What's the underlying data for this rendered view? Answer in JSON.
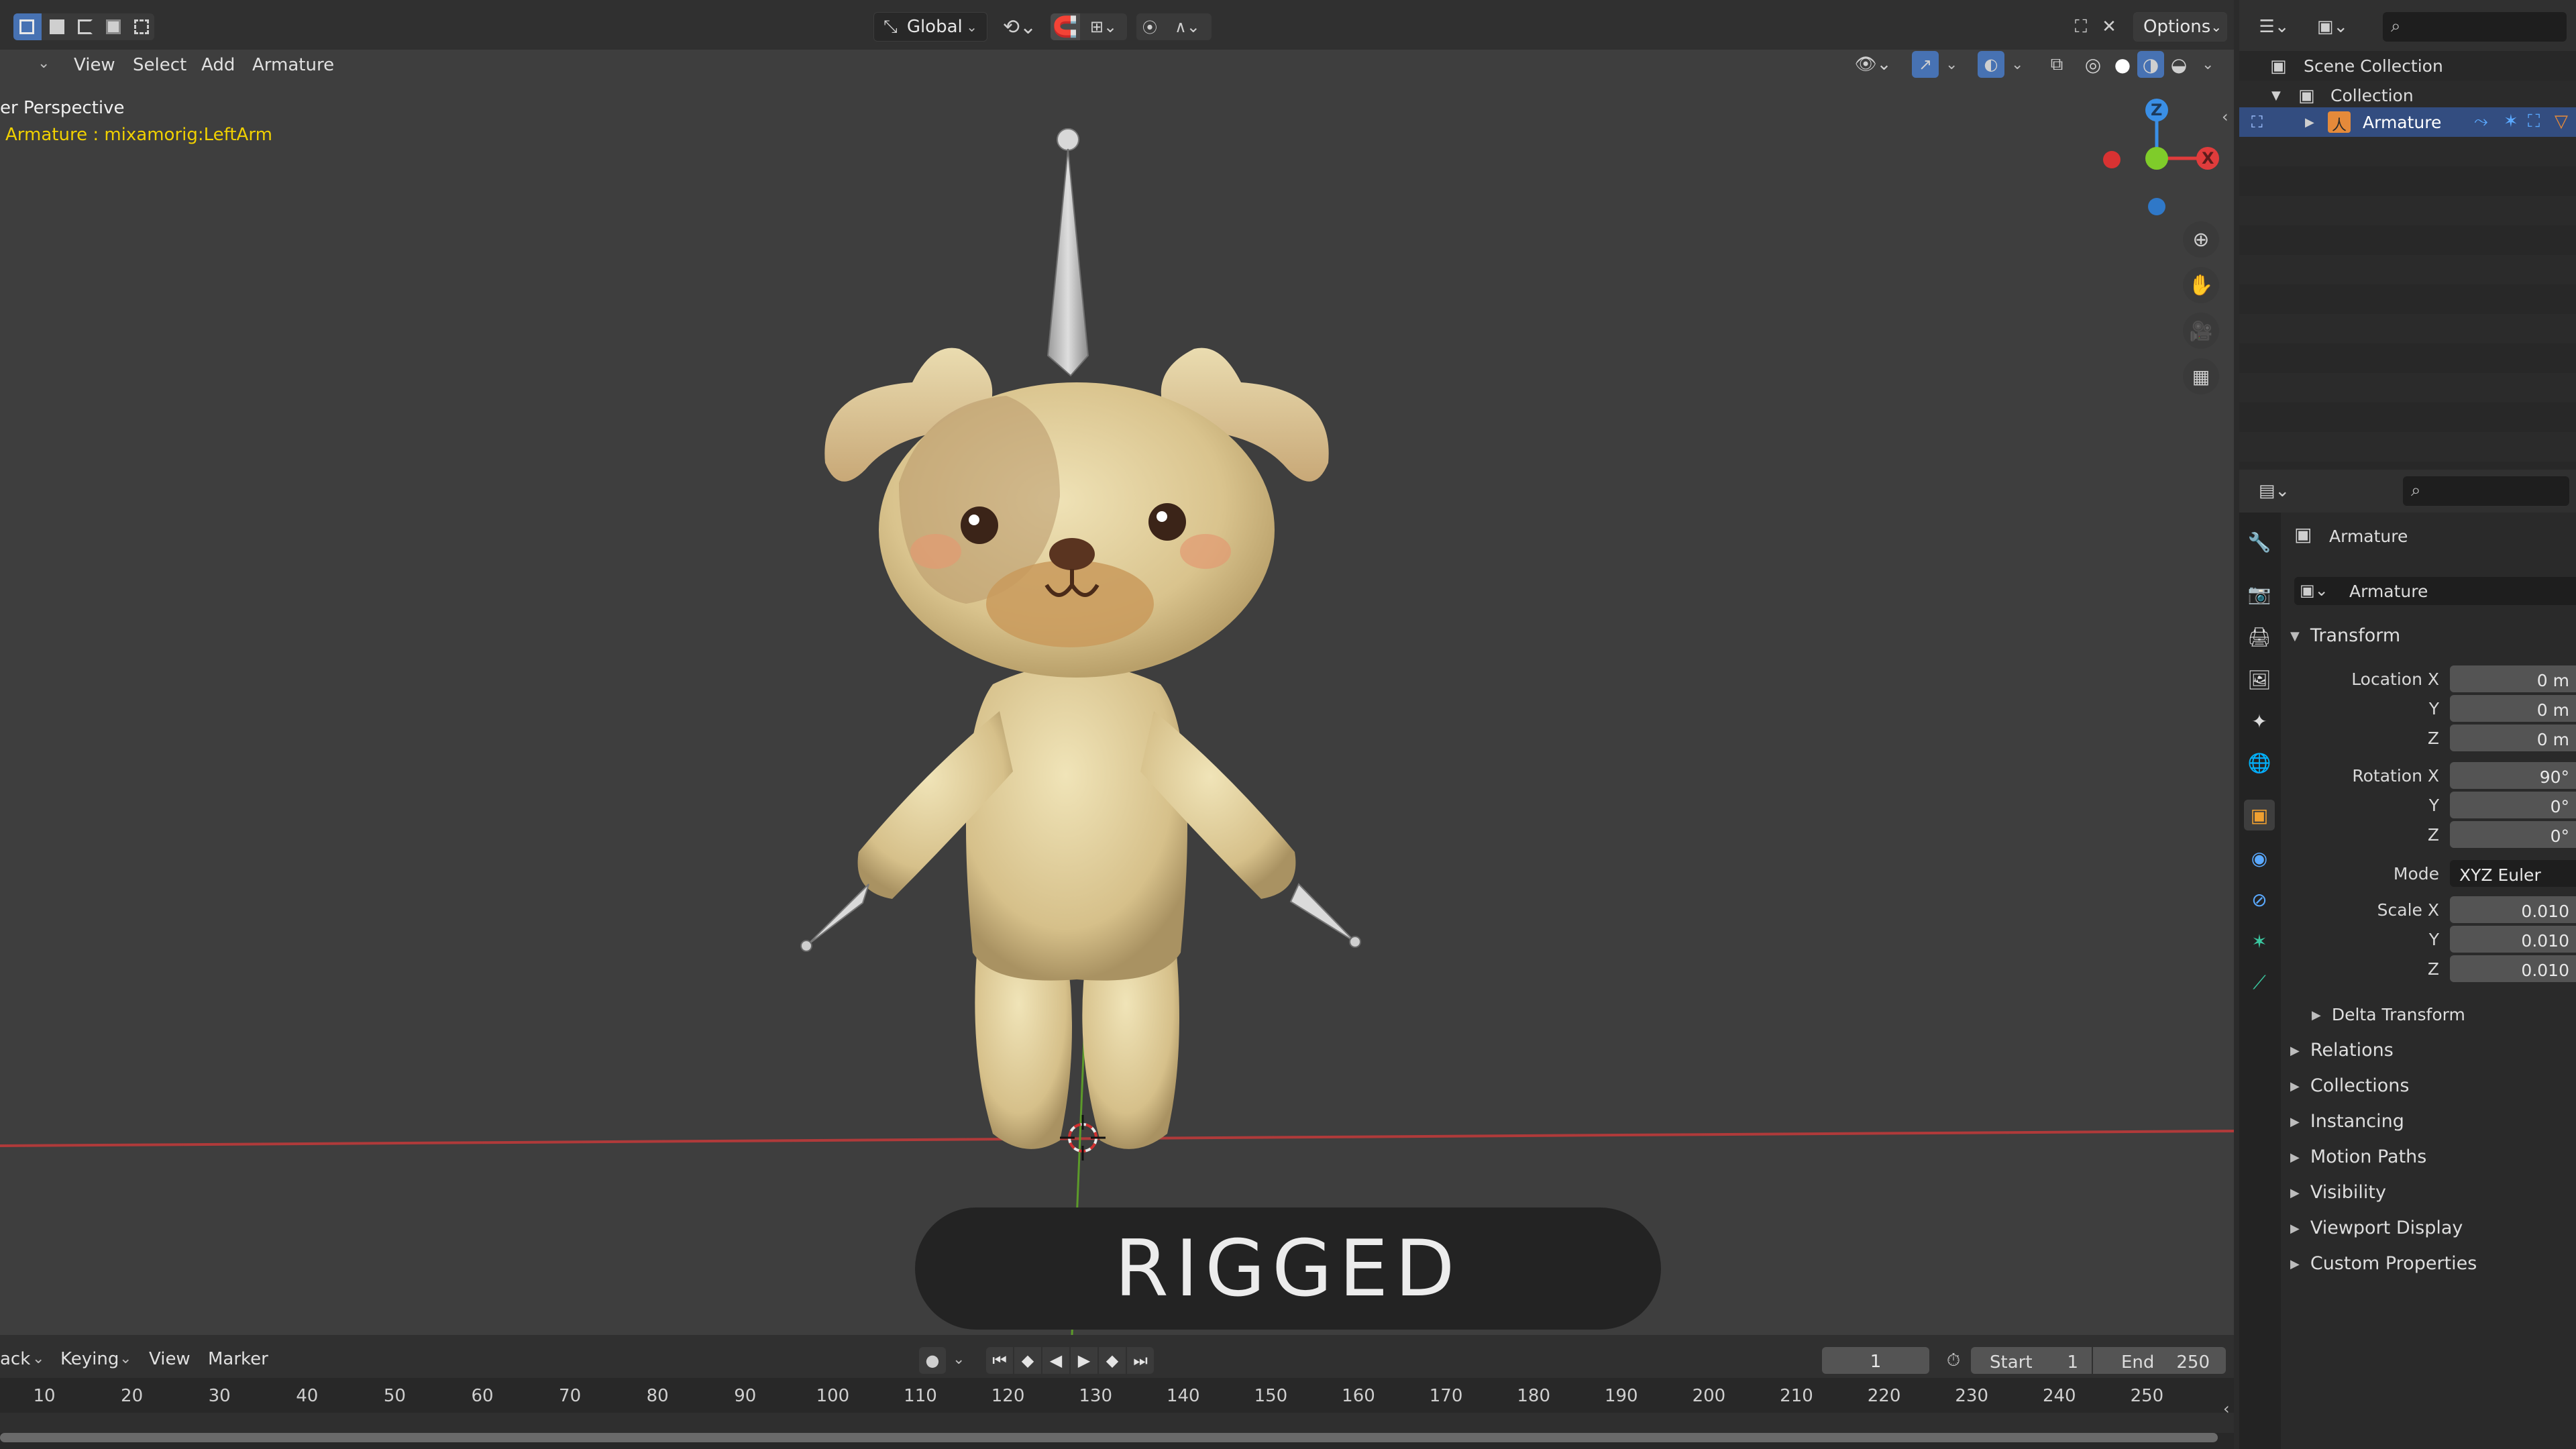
{
  "header": {
    "orientation": "Global",
    "options_label": "Options",
    "menus": [
      "View",
      "Select",
      "Add",
      "Armature"
    ]
  },
  "viewport": {
    "perspective_label": "er Perspective",
    "object_label": "Armature : mixamorig:LeftArm",
    "overlay_banner": "RIGGED",
    "gizmo": {
      "z": "Z",
      "x": "X"
    }
  },
  "outliner": {
    "root": "Scene Collection",
    "collection": "Collection",
    "selected_item": "Armature"
  },
  "properties": {
    "object_name": "Armature",
    "datablock_name": "Armature",
    "transform": {
      "title": "Transform",
      "location_label": "Location X",
      "location": [
        "0 m",
        "0 m",
        "0 m"
      ],
      "rotation_label": "Rotation X",
      "rotation": [
        "90°",
        "0°",
        "0°"
      ],
      "mode_label": "Mode",
      "mode_value": "XYZ Euler",
      "scale_label": "Scale X",
      "scale": [
        "0.010",
        "0.010",
        "0.010"
      ],
      "y": "Y",
      "z": "Z"
    },
    "sub_sections": [
      "Delta Transform"
    ],
    "sections": [
      "Relations",
      "Collections",
      "Instancing",
      "Motion Paths",
      "Visibility",
      "Viewport Display",
      "Custom Properties"
    ]
  },
  "timeline": {
    "menus": [
      "ack",
      "Keying",
      "View",
      "Marker"
    ],
    "current_frame": "1",
    "start_label": "Start",
    "start_value": "1",
    "end_label": "End",
    "end_value": "250",
    "ticks": [
      "10",
      "20",
      "30",
      "40",
      "50",
      "60",
      "70",
      "80",
      "90",
      "100",
      "110",
      "120",
      "130",
      "140",
      "150",
      "160",
      "170",
      "180",
      "190",
      "200",
      "210",
      "220",
      "230",
      "240",
      "250"
    ]
  },
  "colors": {
    "accent": "#4772b3",
    "axis_x": "#e03c3c",
    "axis_y": "#7fcc2a",
    "axis_z": "#3a8fe6",
    "object_text": "#f0d000"
  }
}
